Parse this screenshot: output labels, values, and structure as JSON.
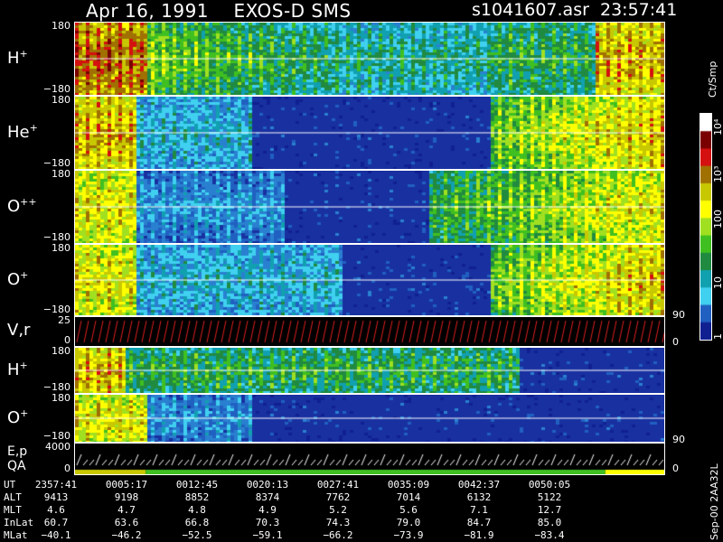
{
  "header": {
    "title": "Apr 16, 1991    EXOS-D SMS",
    "file_time": "s1041607.asr  23:57:41"
  },
  "colorbar": {
    "units": "Ct/Smp",
    "ticks": [
      "10⁴",
      "10³",
      "100",
      "10",
      "1"
    ],
    "colors": [
      "#ffffff",
      "#7a0000",
      "#d41010",
      "#a07000",
      "#c8c800",
      "#ffff00",
      "#a0e020",
      "#40c020",
      "#208a40",
      "#10a0b0",
      "#40d0f0",
      "#2060c0",
      "#102090"
    ]
  },
  "panels": [
    {
      "label": "H",
      "sup": "+",
      "top_tick": "180",
      "bottom_tick": "−180"
    },
    {
      "label": "He",
      "sup": "+",
      "top_tick": "180",
      "bottom_tick": "−180"
    },
    {
      "label": "O",
      "sup": "++",
      "top_tick": "180",
      "bottom_tick": "−180"
    },
    {
      "label": "O",
      "sup": "+",
      "top_tick": "180",
      "bottom_tick": "−180"
    },
    {
      "label": "V,r",
      "sup": "",
      "top_tick": "25",
      "bottom_tick": "0"
    },
    {
      "label": "H",
      "sup": "+",
      "top_tick": "180",
      "bottom_tick": "−180"
    },
    {
      "label": "O",
      "sup": "+",
      "top_tick": "180",
      "bottom_tick": "−180"
    },
    {
      "label": "E,p",
      "sub2": "QA",
      "top_tick": "4000",
      "bottom_tick": "0"
    }
  ],
  "right_ticks": {
    "p4": "90",
    "p5a": "0",
    "p7": "90",
    "p8": "0"
  },
  "orbit_table": {
    "rows": [
      {
        "label": "UT",
        "values": [
          "2357:41",
          "0005:17",
          "0012:45",
          "0020:13",
          "0027:41",
          "0035:09",
          "0042:37",
          "0050:05"
        ]
      },
      {
        "label": "ALT",
        "values": [
          "9413",
          "9198",
          "8852",
          "8374",
          "7762",
          "7014",
          "6132",
          "5122"
        ]
      },
      {
        "label": "MLT",
        "values": [
          "4.6",
          "4.7",
          "4.8",
          "4.9",
          "5.2",
          "5.6",
          "7.1",
          "12.7"
        ]
      },
      {
        "label": "InLat",
        "values": [
          "60.7",
          "63.6",
          "66.8",
          "70.3",
          "74.3",
          "79.0",
          "84.7",
          "85.0"
        ]
      },
      {
        "label": "MLat",
        "values": [
          "−40.1",
          "−46.2",
          "−52.5",
          "−59.1",
          "−66.2",
          "−73.9",
          "−81.9",
          "−83.4"
        ]
      }
    ]
  },
  "footer_vertical": "Sep-00  2AA32L"
}
